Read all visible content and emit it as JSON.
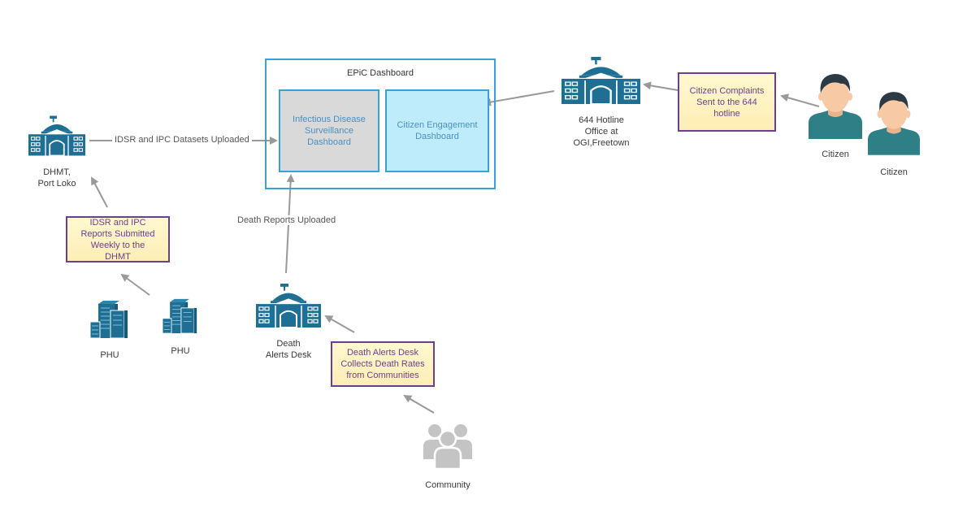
{
  "dashboard": {
    "title": "EPiC Dashboard",
    "panels": [
      {
        "label": "Infectious Disease Surveillance Dashboard"
      },
      {
        "label": "Citizen Engagement Dashboard"
      }
    ]
  },
  "nodes": {
    "dhmt": {
      "label_line1": "DHMT,",
      "label_line2": "Port Loko",
      "icon": "government-building-icon"
    },
    "hotline": {
      "label_line1": "644 Hotline",
      "label_line2": "Office at",
      "label_line3": "OGI,Freetown",
      "icon": "government-building-icon"
    },
    "death_desk": {
      "label_line1": "Death",
      "label_line2": "Alerts Desk",
      "icon": "government-building-icon"
    },
    "phu_1": {
      "label": "PHU",
      "icon": "office-buildings-icon"
    },
    "phu_2": {
      "label": "PHU",
      "icon": "office-buildings-icon"
    },
    "citizen_1": {
      "label": "Citizen",
      "icon": "person-icon"
    },
    "citizen_2": {
      "label": "Citizen",
      "icon": "person-icon"
    },
    "community": {
      "label": "Community",
      "icon": "group-icon"
    }
  },
  "notes": {
    "idsr_reports": {
      "line1": "IDSR and IPC",
      "line2": "Reports Submitted",
      "line3": "Weekly  to the",
      "line4": "DHMT"
    },
    "citizen_complaints": {
      "line1": "Citizen Complaints",
      "line2": "Sent to the 644",
      "line3": "hotline"
    },
    "death_alerts": {
      "line1": "Death Alerts Desk",
      "line2": "Collects Death Rates",
      "line3": "from Communities"
    }
  },
  "edges": {
    "idsr_upload": "IDSR and IPC Datasets Uploaded",
    "death_upload": "Death Reports Uploaded"
  },
  "colors": {
    "icon_blue": "#1f6f94",
    "dashboard_border": "#3aa0d8",
    "note_border": "#6b3f8e",
    "note_fill": "#fdf2c4",
    "arrow": "#999999",
    "shirt": "#2f7f86",
    "hair": "#2b3a44",
    "skin": "#f7c9a4",
    "community_grey": "#c4c4c4"
  }
}
